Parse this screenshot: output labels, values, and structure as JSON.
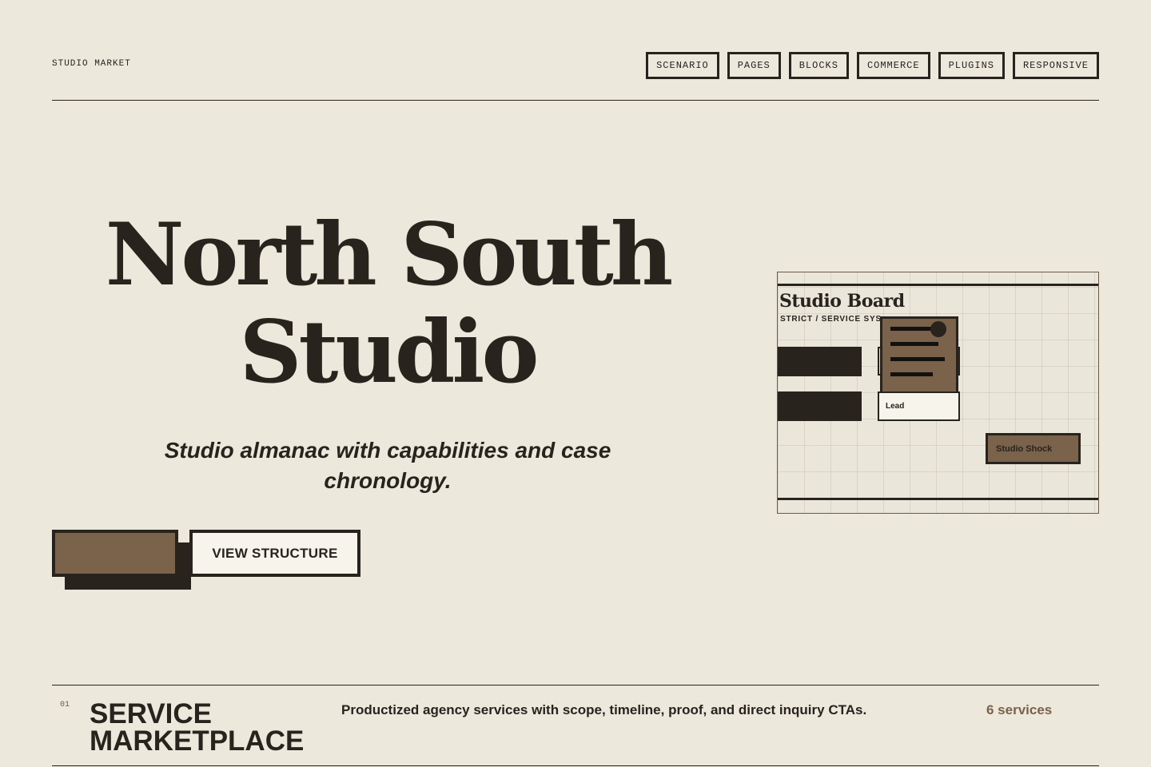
{
  "brand": "STUDIO MARKET",
  "nav": [
    "SCENARIO",
    "PAGES",
    "BLOCKS",
    "COMMERCE",
    "PLUGINS",
    "RESPONSIVE"
  ],
  "hero": {
    "title": "North South Studio",
    "subtitle": "Studio almanac with capabilities and case chronology.",
    "primary_label": "",
    "secondary_label": "VIEW STRUCTURE"
  },
  "board": {
    "title": "Studio Board",
    "subtitle": "STRICT / SERVICE SYS",
    "lead_label": "Lead",
    "shock_label": "Studio Shock"
  },
  "section": {
    "number": "01",
    "title": "SERVICE MARKETPLACE",
    "description": "Productized agency services with scope, timeline, proof, and direct inquiry CTAs.",
    "count": "6 services"
  },
  "colors": {
    "background": "#ede8dc",
    "ink": "#28231d",
    "accent": "#7a624b",
    "paper": "#f7f4ec"
  }
}
